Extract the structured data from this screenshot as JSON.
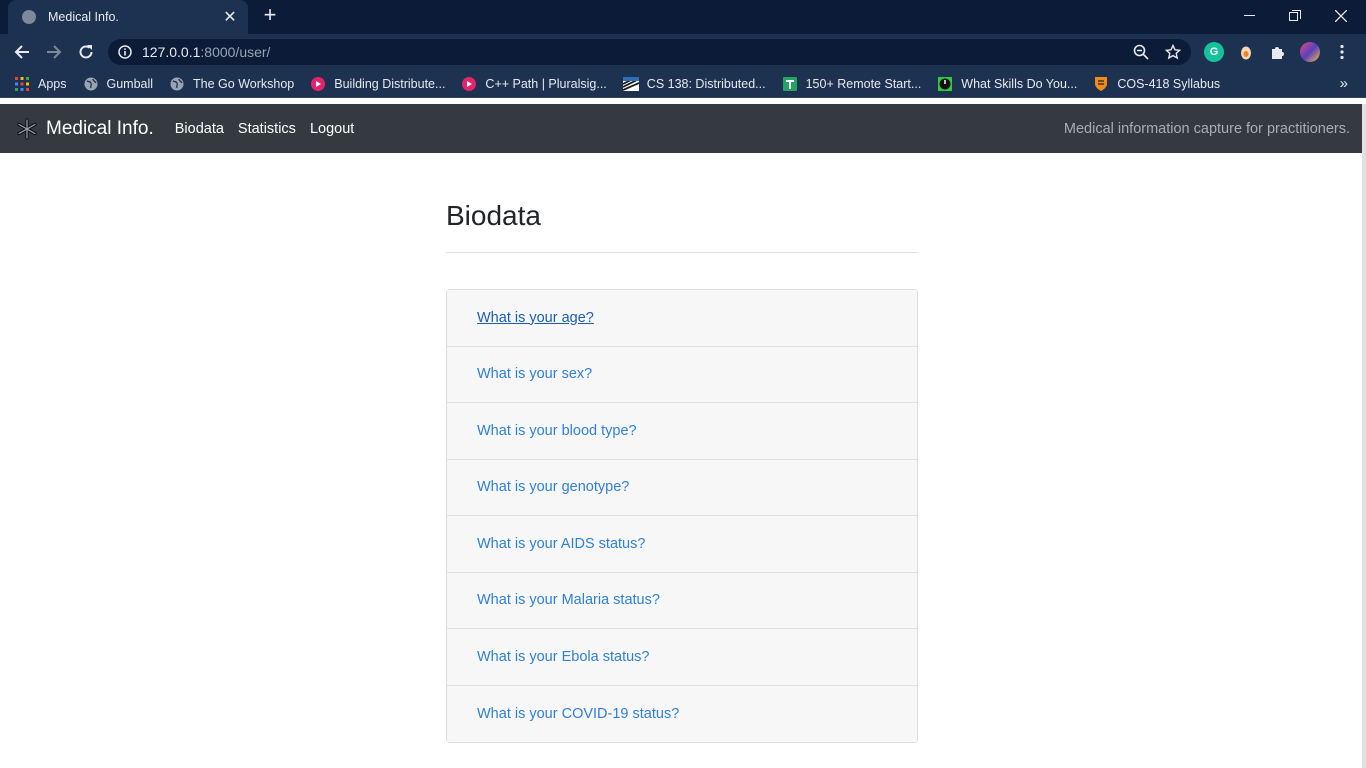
{
  "browser": {
    "tab_title": "Medical Info.",
    "url_host": "127.0.0.1",
    "url_rest": ":8000/user/",
    "bookmarks": [
      {
        "label": "Apps",
        "icon": "apps-grid-icon"
      },
      {
        "label": "Gumball",
        "icon": "globe-icon"
      },
      {
        "label": "The Go Workshop",
        "icon": "globe-icon"
      },
      {
        "label": "Building Distribute...",
        "icon": "pluralsight-icon"
      },
      {
        "label": "C++ Path | Pluralsig...",
        "icon": "pluralsight-icon"
      },
      {
        "label": "CS 138: Distributed...",
        "icon": "cs138-icon"
      },
      {
        "label": "150+ Remote Start...",
        "icon": "green-doc-icon"
      },
      {
        "label": "What Skills Do You...",
        "icon": "power-icon"
      },
      {
        "label": "COS-418 Syllabus",
        "icon": "shield-icon"
      }
    ],
    "more_bookmarks": "»"
  },
  "navbar": {
    "brand": "Medical Info.",
    "links": [
      "Biodata",
      "Statistics",
      "Logout"
    ],
    "tagline": "Medical information capture for practitioners."
  },
  "page": {
    "heading": "Biodata",
    "questions": [
      "What is your age?",
      "What is your sex?",
      "What is your blood type?",
      "What is your genotype?",
      "What is your AIDS status?",
      "What is your Malaria status?",
      "What is your Ebola status?",
      "What is your COVID-19 status?"
    ]
  },
  "colors": {
    "navbar_bg": "#343a40",
    "link": "#2f80d8",
    "chrome_dark": "#0c1c38",
    "chrome_light": "#1d3150"
  }
}
